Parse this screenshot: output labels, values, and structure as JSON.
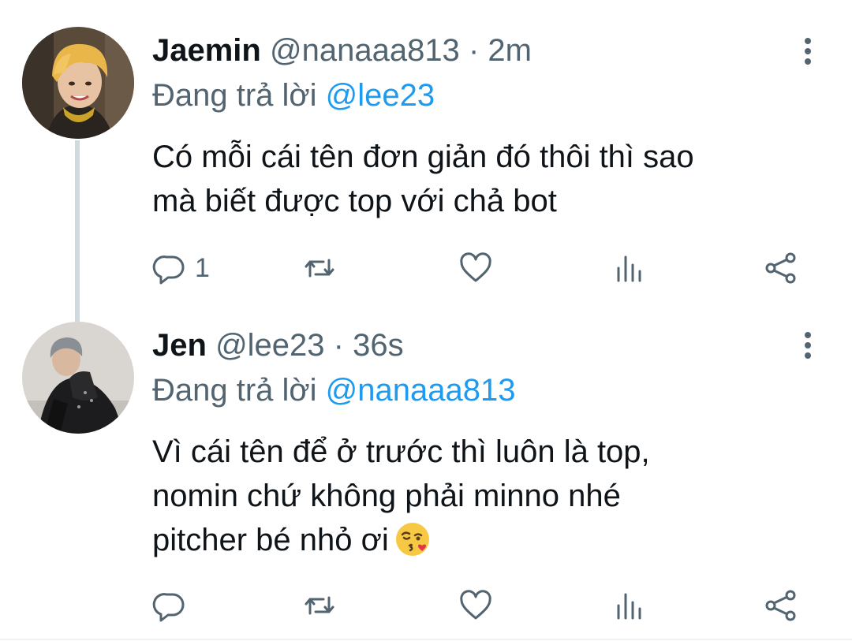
{
  "tweets": [
    {
      "display_name": "Jaemin",
      "handle": "@nanaaa813",
      "separator": "·",
      "time": "2m",
      "reply_prefix": "Đang trả lời",
      "reply_to": "@lee23",
      "text_lines": [
        "Có mỗi cái tên đơn giản đó thôi thì sao",
        "mà biết được top với chả bot"
      ],
      "reply_count": "1"
    },
    {
      "display_name": "Jen",
      "handle": "@lee23",
      "separator": "·",
      "time": "36s",
      "reply_prefix": "Đang trả lời",
      "reply_to": "@nanaaa813",
      "text_lines": [
        "Vì cái tên để ở trước thì luôn là top,",
        "nomin chứ không phải minno nhé",
        "pitcher bé nhỏ ơi"
      ],
      "emoji": "face-blowing-a-kiss-icon",
      "reply_count": ""
    }
  ],
  "icons": {
    "reply": "reply-icon",
    "retweet": "retweet-icon",
    "like": "heart-icon",
    "stats": "analytics-icon",
    "share": "share-icon",
    "more": "more-vertical-icon"
  },
  "colors": {
    "text": "#0f1419",
    "secondary": "#536471",
    "link": "#1d9bf0",
    "thread_line": "#cfd9de"
  }
}
